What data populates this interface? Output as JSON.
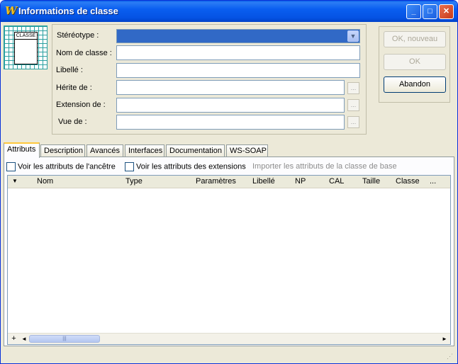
{
  "window": {
    "title": "Informations de classe",
    "app_icon_glyph": "W",
    "controls": {
      "minimize": "_",
      "maximize": "□",
      "close": "✕"
    }
  },
  "class_icon": {
    "label": "CLASSE"
  },
  "form": {
    "stereotype_label": "Stéréotype :",
    "stereotype_value": "",
    "class_name_label": "Nom de classe :",
    "class_name_value": "",
    "libelle_label": "Libellé :",
    "libelle_value": "",
    "herite_label": "Hérite de :",
    "herite_value": "",
    "extension_label": "Extension de :",
    "extension_value": "",
    "vue_label": "Vue de :",
    "vue_value": "",
    "browse_glyph": "...",
    "dropdown_glyph": "▼"
  },
  "buttons": {
    "ok_new": "OK, nouveau",
    "ok": "OK",
    "cancel": "Abandon"
  },
  "tabs": [
    {
      "label": "Attributs"
    },
    {
      "label": "Description"
    },
    {
      "label": "Avancés"
    },
    {
      "label": "Interfaces"
    },
    {
      "label": "Documentation"
    },
    {
      "label": "WS-SOAP"
    }
  ],
  "attributes_tab": {
    "show_ancestor": "Voir les attributs de l'ancêtre",
    "show_extensions": "Voir les attributs des extensions",
    "import_base": "Importer les attributs de la classe de base",
    "columns": [
      "Nom",
      "Type",
      "Paramètres",
      "Libellé",
      "NP",
      "CAL",
      "Taille",
      "Classe",
      "..."
    ],
    "sort_glyph": "▼",
    "rows": []
  },
  "scrollbar": {
    "plus": "+",
    "left": "◄",
    "right": "►",
    "thumb_grip": "|||"
  },
  "colors": {
    "title_bar": "#0a5ef0",
    "selection": "#3169c6",
    "face": "#ece9d8"
  }
}
